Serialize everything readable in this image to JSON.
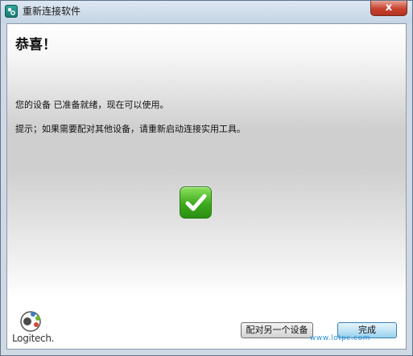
{
  "window": {
    "title": "重新连接软件",
    "close_label": "x"
  },
  "content": {
    "heading": "恭喜！",
    "message": "您的设备 已准备就绪，现在可以使用。",
    "hint": "提示；如果需要配对其他设备，请重新启动连接实用工具。"
  },
  "icons": {
    "app": "logitech-connect-app-icon",
    "status": "green-checkmark-icon"
  },
  "brand": {
    "logo_text": "Logitech."
  },
  "buttons": {
    "pair_another": "配对另一个设备",
    "finish": "完成"
  },
  "watermark": "www.lotpc.com",
  "colors": {
    "close_button": "#c7422f",
    "check_green": "#3daa1e",
    "finish_button": "#98d1ef"
  }
}
